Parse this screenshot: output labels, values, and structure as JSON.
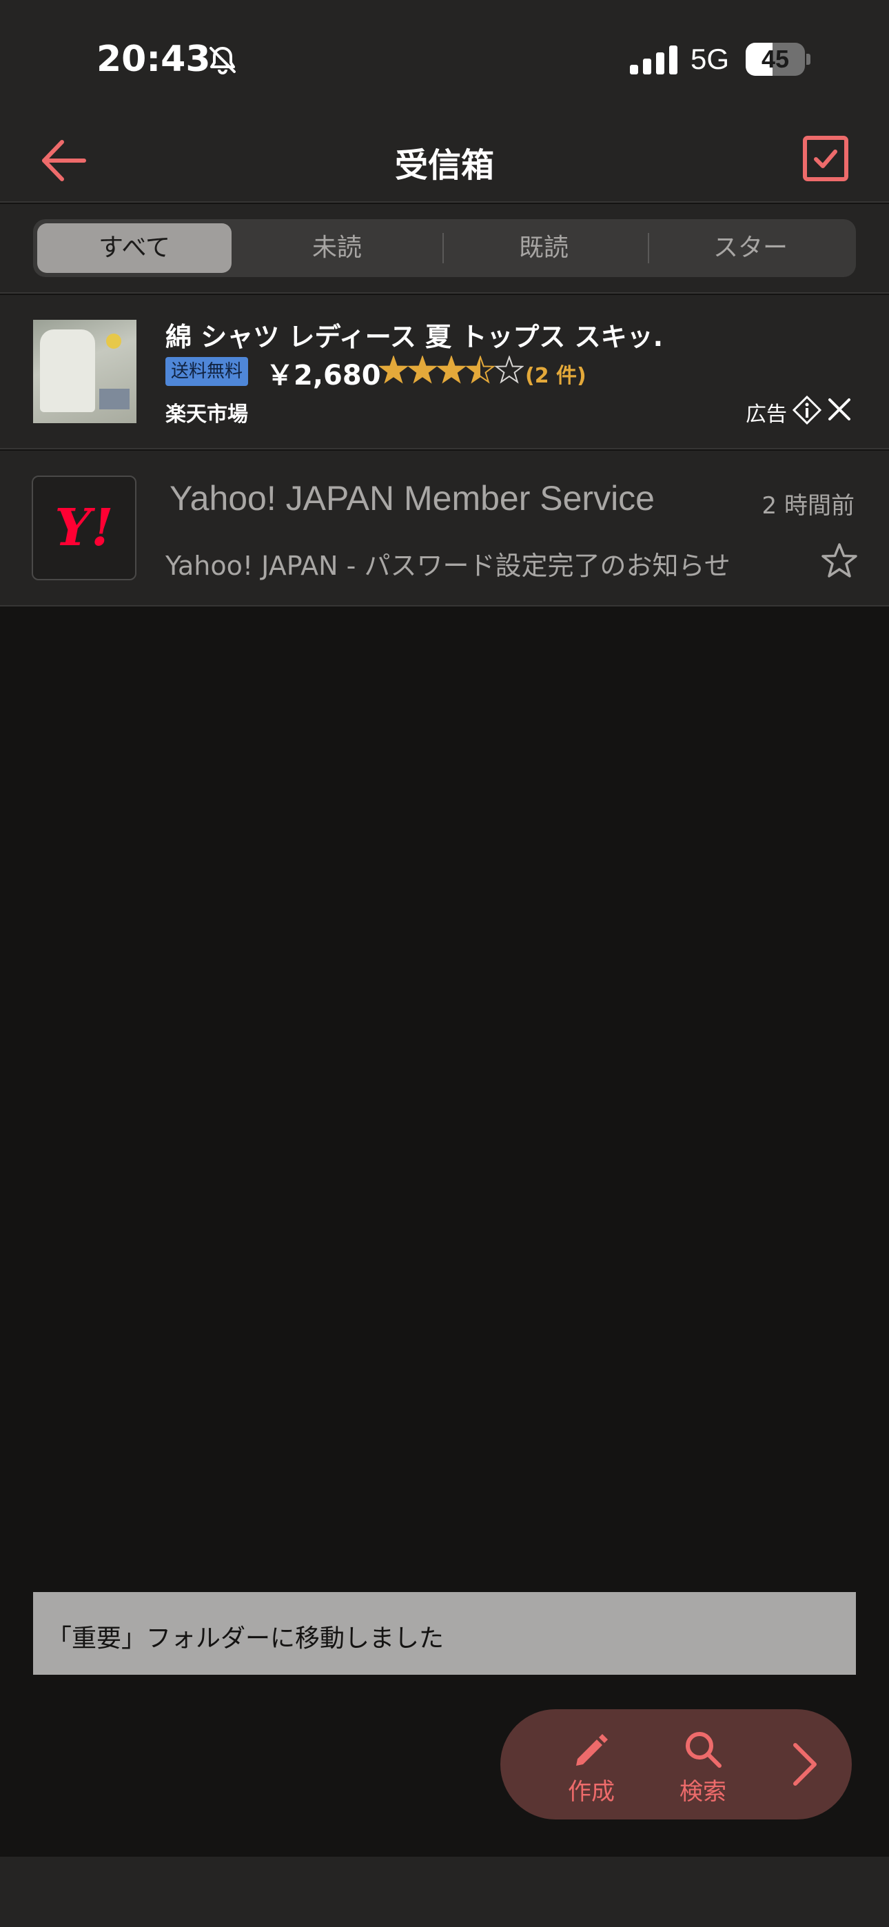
{
  "status_bar": {
    "time": "20:43",
    "network": "5G",
    "battery": "45",
    "battery_level": 0.45
  },
  "nav": {
    "title": "受信箱"
  },
  "tabs": [
    {
      "label": "すべて",
      "active": true
    },
    {
      "label": "未読",
      "active": false
    },
    {
      "label": "既読",
      "active": false
    },
    {
      "label": "スター",
      "active": false
    }
  ],
  "ad": {
    "title": "綿 シャツ レディース 夏 トップス スキッ...",
    "badge": "送料無料",
    "price": "￥2,680",
    "rating": 3.5,
    "review_count": "(2 件)",
    "shop": "楽天市場",
    "label": "広告"
  },
  "mail": {
    "sender": "Yahoo! JAPAN Member Service",
    "time": "2 時間前",
    "subject": "Yahoo! JAPAN - パスワード設定完了のお知らせ",
    "avatar_text": "Y!"
  },
  "toast": {
    "message": "「重要」フォルダーに移動しました"
  },
  "fab": {
    "compose_label": "作成",
    "search_label": "検索"
  },
  "colors": {
    "accent": "#ee6b6b",
    "background": "#141312",
    "surface": "#252423"
  }
}
